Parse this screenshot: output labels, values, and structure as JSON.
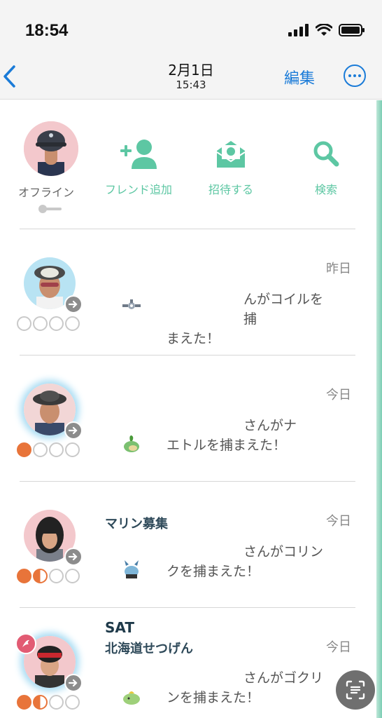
{
  "status": {
    "time": "18:54"
  },
  "nav": {
    "date": "2月1日",
    "time": "15:43",
    "edit": "編集"
  },
  "me": {
    "status": "オフライン"
  },
  "actions": {
    "add_friend": "フレンド追加",
    "invite": "招待する",
    "search": "検索"
  },
  "friends": [
    {
      "name": "",
      "day": "昨日",
      "msg1": "んがコイルを捕",
      "msg2": "まえた！",
      "hearts": 0,
      "pokemon": "magnemite-icon"
    },
    {
      "name": "",
      "day": "今日",
      "msg1": "さんがナ",
      "msg2": "エトルを捕まえた！",
      "hearts": 1,
      "pokemon": "turtwig-icon"
    },
    {
      "name": "マリン募集",
      "day": "今日",
      "msg1": "さんがコリン",
      "msg2": "クを捕まえた！",
      "hearts": 1.5,
      "pokemon": "shinx-icon"
    },
    {
      "name": "SAT",
      "name2": "北海道せつげん",
      "day": "今日",
      "msg1": "さんがゴクリ",
      "msg2": "ンを捕まえた！",
      "hearts": 1.5,
      "pokemon": "gulpin-icon"
    }
  ],
  "colors": {
    "accent": "#5dc7a3",
    "link": "#1a7bd8",
    "heart": "#e8743a"
  }
}
